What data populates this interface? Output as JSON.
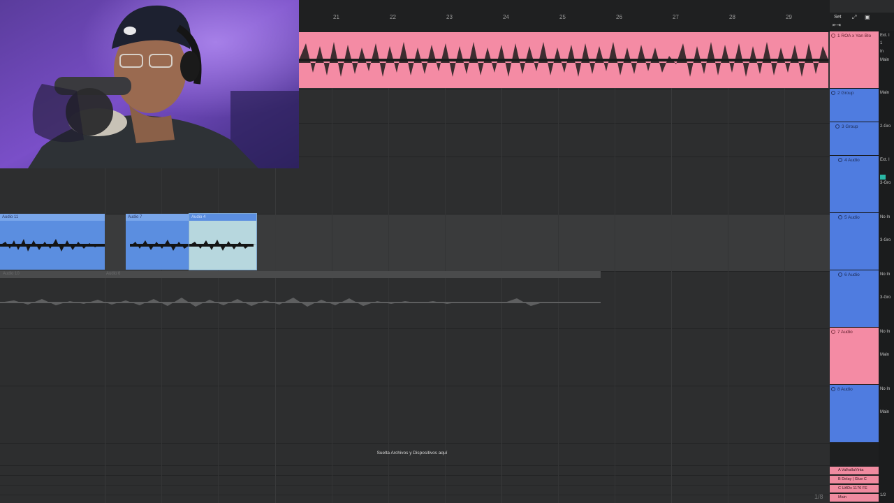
{
  "ruler": {
    "bars": [
      "21",
      "22",
      "23",
      "24",
      "25",
      "26",
      "27",
      "28",
      "29"
    ],
    "set_button": "Set"
  },
  "clips": {
    "lane1": "Audio 11",
    "lane2": "Audio 7",
    "lane3": "Audio 4",
    "ghost1": "Audio 10",
    "ghost2": "Audio 6"
  },
  "drop_hint": "Suelta Archivos y Dispositivos aquí",
  "tracks": [
    {
      "label": "1 ROA x Yan Blo",
      "color": "#f48ba4"
    },
    {
      "label": "2 Group",
      "color": "#4f7ce0"
    },
    {
      "label": "3 Group",
      "color": "#4f7ce0"
    },
    {
      "label": "4 Audio",
      "color": "#4f7ce0"
    },
    {
      "label": "5 Audio",
      "color": "#4f7ce0"
    },
    {
      "label": "6 Audio",
      "color": "#4f7ce0"
    },
    {
      "label": "7 Audio",
      "color": "#f48ba4"
    },
    {
      "label": "8 Audio",
      "color": "#4f7ce0"
    }
  ],
  "io": {
    "t1a": "Ext. I",
    "t1b": "1",
    "t1c": "In",
    "t1d": "Main",
    "t2": "Main",
    "t3": "2-Gro",
    "t4a": "Ext. I",
    "t4b": "3-Gro",
    "t5a": "No In",
    "t5b": "3-Gro",
    "t6a": "No In",
    "t6b": "3-Gro",
    "t7a": "No In",
    "t7b": "Main",
    "t8a": "No In",
    "t8b": "Main",
    "r1": "1/2"
  },
  "returns": [
    {
      "label": "A ValhallaVinta"
    },
    {
      "label": "B Delay | Glue C"
    },
    {
      "label": "C UADx 1176 FE"
    },
    {
      "label": "Main"
    }
  ],
  "zoom_readout": "1/8",
  "colors": {
    "pink": "#f48ba4",
    "blue": "#4f7ce0",
    "clip_blue": "#5b8ee0",
    "clip_selected": "#b7d7de"
  }
}
